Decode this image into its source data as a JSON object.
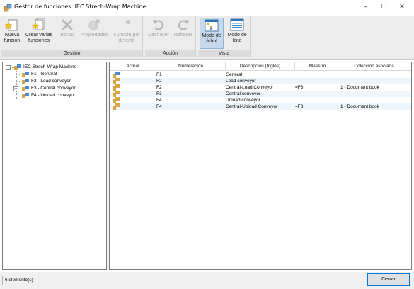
{
  "window": {
    "title": "Gestor de funciones: IEC Strech-Wrap Machine",
    "minimize": "–",
    "maximize": "☐",
    "close": "✕"
  },
  "ribbon": {
    "groups": {
      "gestion": {
        "label": "Gestión",
        "buttons": {
          "nueva_funcion": "Nueva función",
          "crear_varias": "Crear varias funciones",
          "borrar": "Borrar",
          "propiedades": "Propiedades",
          "funcion_defecto": "Función por defecto"
        }
      },
      "accion": {
        "label": "Acción",
        "buttons": {
          "deshacer": "Deshacer",
          "rehacer": "Rehacer"
        }
      },
      "vista": {
        "label": "Vista",
        "buttons": {
          "arbol": "Modo de árbol",
          "lista": "Modo de lista"
        }
      }
    }
  },
  "tree": {
    "root": "IEC Strech-Wrap Machine",
    "items": [
      {
        "label": "F1 - General"
      },
      {
        "label": "F2 - Load conveyor"
      },
      {
        "label": "F3 - Central conveyor"
      },
      {
        "label": "F4 - Unload conveyor"
      }
    ]
  },
  "list": {
    "columns": [
      "Actual",
      "Numeración",
      "Descripción (Inglés)",
      "Maestro",
      "Colección asociada"
    ],
    "rows": [
      {
        "numeracion": "F1",
        "descripcion": "General",
        "maestro": "",
        "coleccion": ""
      },
      {
        "numeracion": "F2",
        "descripcion": "Load conveyor",
        "maestro": "",
        "coleccion": ""
      },
      {
        "numeracion": "F2",
        "descripcion": "Central-Load Conveyor",
        "maestro": "=F3",
        "coleccion": "1 - Document book"
      },
      {
        "numeracion": "F3",
        "descripcion": "Central conveyor",
        "maestro": "",
        "coleccion": ""
      },
      {
        "numeracion": "F4",
        "descripcion": "Unload conveyor",
        "maestro": "",
        "coleccion": ""
      },
      {
        "numeracion": "F4",
        "descripcion": "Central-Upload Conveyor",
        "maestro": "=F3",
        "coleccion": "1 - Document book"
      }
    ]
  },
  "status": {
    "count": "6 elemento(s)",
    "close_button": "Cerrar"
  },
  "colors": {
    "ribbon_bg": "#ececec",
    "active_button": "#c6d8ec",
    "row_alt": "#eef6fb",
    "button_border": "#0078d7"
  }
}
